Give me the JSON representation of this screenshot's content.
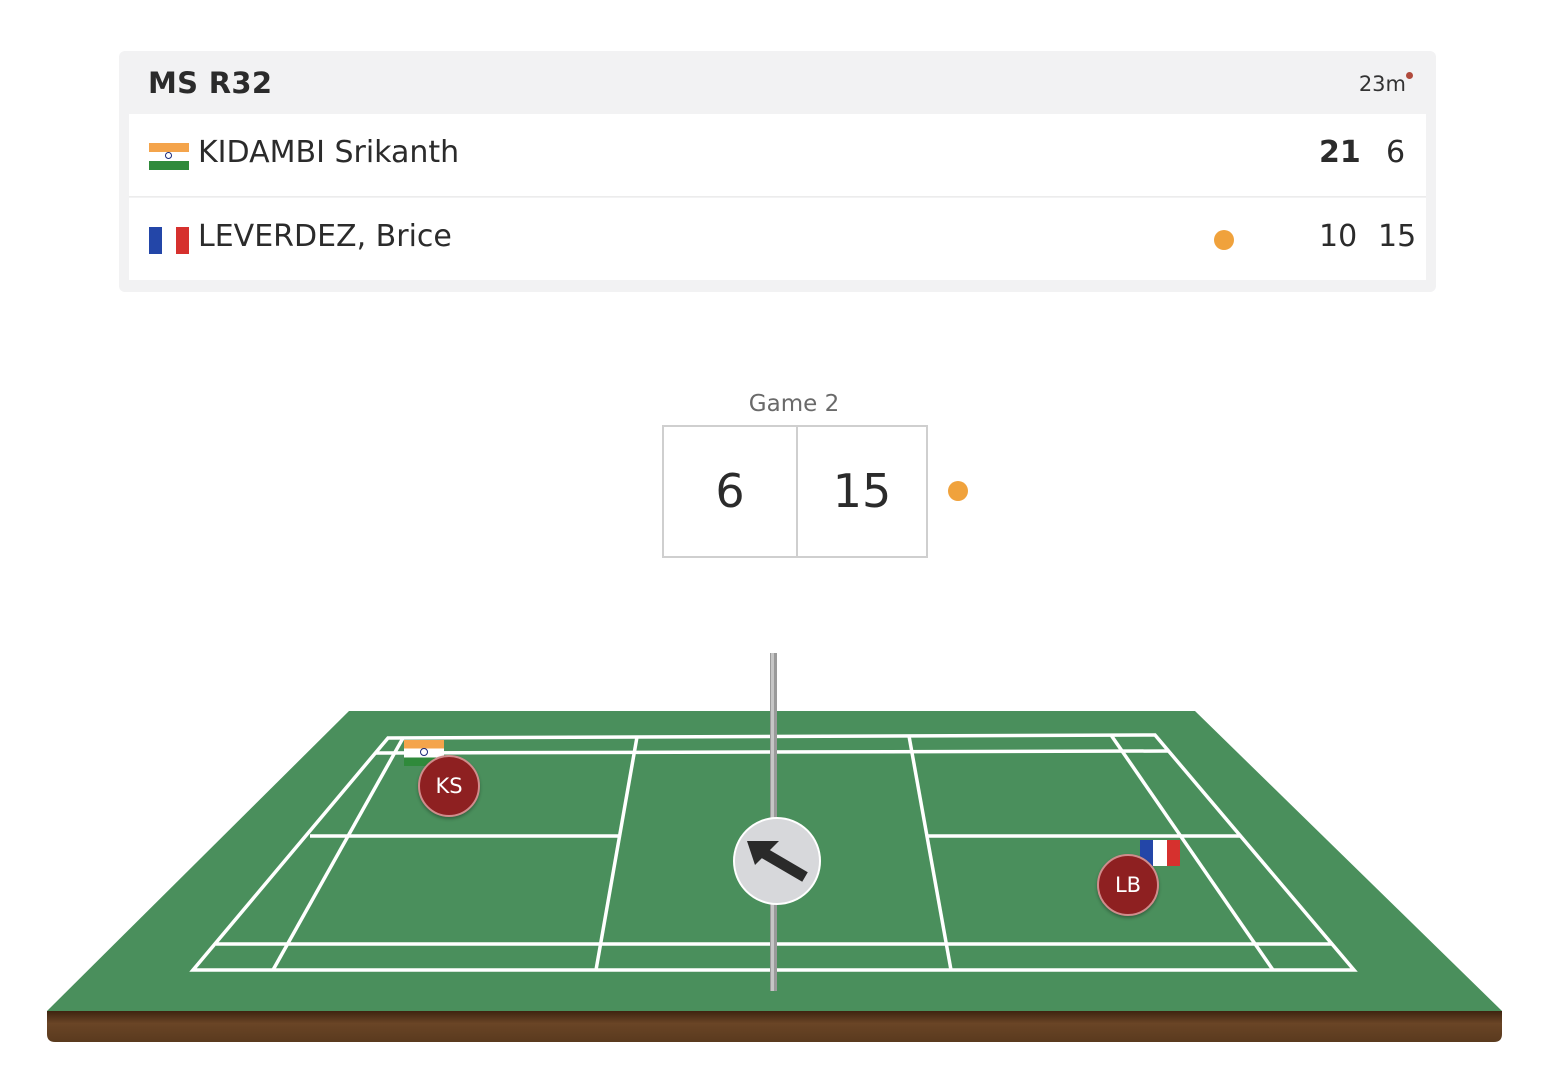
{
  "match": {
    "round": "MS R32",
    "duration": "23m",
    "live_indicator_color": "#b04a3c"
  },
  "players": [
    {
      "name": "KIDAMBI Srikanth",
      "country_flag": "india-flag-icon",
      "game_scores": [
        "21",
        "6"
      ],
      "serving": false
    },
    {
      "name": "LEVERDEZ, Brice",
      "country_flag": "france-flag-icon",
      "game_scores": [
        "10",
        "15"
      ],
      "serving": true
    }
  ],
  "current_game": {
    "label": "Game 2",
    "left_score": "6",
    "right_score": "15",
    "server_indicator_color": "#f0a23c"
  },
  "court": {
    "left_player_initials": "KS",
    "right_player_initials": "LB",
    "shuttle_direction_icon": "arrow-up-left-icon",
    "court_color": "#4a8f5c",
    "base_color": "#5a3a1e"
  }
}
